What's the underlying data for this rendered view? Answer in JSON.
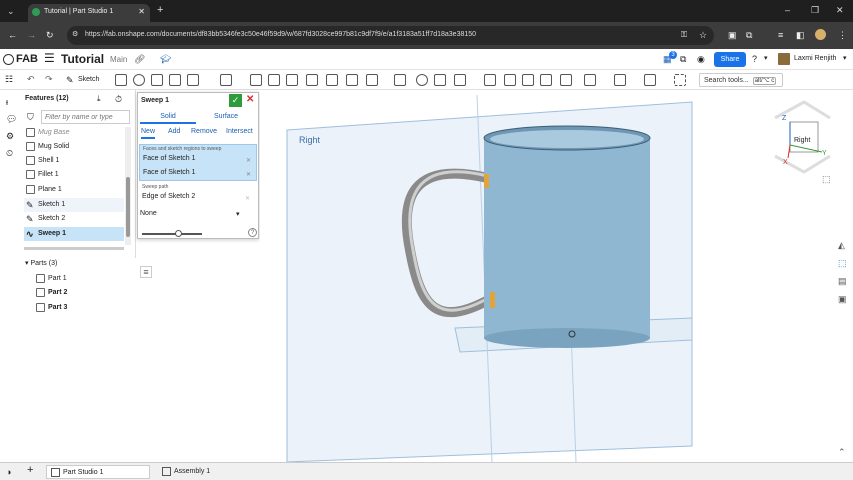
{
  "browser": {
    "tab_title": "Tutorial | Part Studio 1",
    "url": "https://fab.onshape.com/documents/df83bb5346fe3c50e46f59d9/w/687fd3028ce997b81c9df7f9/e/a1f3183a51ff7d18a3e38150"
  },
  "header": {
    "logo": "FAB",
    "doc_title": "Tutorial",
    "branch": "Main",
    "notif_count": "3",
    "share_label": "Share",
    "user_name": "Laxmi Renjith"
  },
  "toolbar": {
    "sketch_label": "Sketch",
    "search_placeholder": "Search tools...",
    "search_shortcut": "alt/⌥ c"
  },
  "features": {
    "title": "Features (12)",
    "filter_placeholder": "Filter by name or type",
    "items": [
      "Mug Base",
      "Mug Solid",
      "Shell 1",
      "Fillet 1",
      "Plane 1",
      "Sketch 1",
      "Sketch 2",
      "Sweep 1"
    ],
    "parts_header": "Parts (3)",
    "parts": [
      "Part 1",
      "Part 2",
      "Part 3"
    ]
  },
  "sweep": {
    "title": "Sweep 1",
    "tab_solid": "Solid",
    "tab_surface": "Surface",
    "ops": [
      "New",
      "Add",
      "Remove",
      "Intersect"
    ],
    "faces_label": "Faces and sketch regions to sweep",
    "face1": "Face of Sketch 1",
    "face2": "Face of Sketch 1",
    "path_label": "Sweep path",
    "path_value": "Edge of Sketch 2",
    "option": "None",
    "slider_value": 0.6
  },
  "viewport": {
    "plane_label": "Right",
    "cube_label": "Right",
    "axis_z": "Z",
    "axis_y": "Y",
    "axis_x": "X"
  },
  "bottom": {
    "tab1": "Part Studio 1",
    "tab2": "Assembly 1"
  },
  "colors": {
    "accent": "#1a73e8",
    "selected_row": "#c7e3f7",
    "confirm": "#2e9c3a",
    "cancel": "#d32f2f",
    "mug": "#8fb7d1",
    "plane": "#c6ddef"
  }
}
